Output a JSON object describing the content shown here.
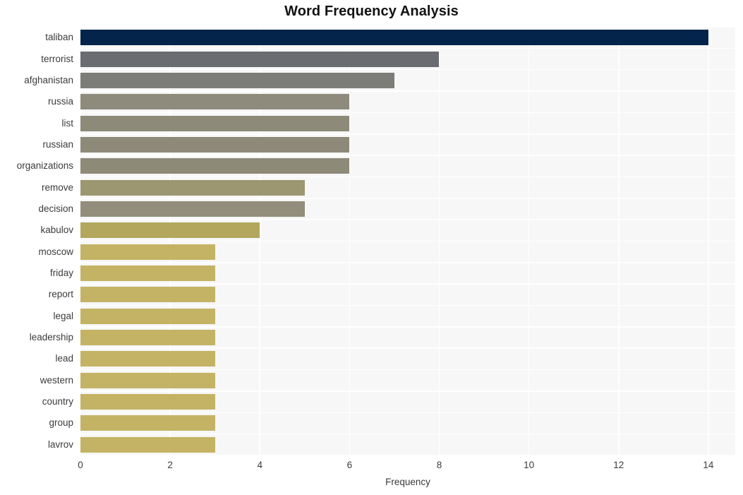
{
  "chart_data": {
    "type": "bar",
    "orientation": "horizontal",
    "title": "Word Frequency Analysis",
    "xlabel": "Frequency",
    "ylabel": "",
    "xlim": [
      0,
      14.6
    ],
    "xticks": [
      0,
      2,
      4,
      6,
      8,
      10,
      12,
      14
    ],
    "xticklabels": [
      "0",
      "2",
      "4",
      "6",
      "8",
      "10",
      "12",
      "14"
    ],
    "grid": true,
    "legend": null,
    "categories": [
      "taliban",
      "terrorist",
      "afghanistan",
      "russia",
      "list",
      "russian",
      "organizations",
      "remove",
      "decision",
      "kabulov",
      "moscow",
      "friday",
      "report",
      "legal",
      "leadership",
      "lead",
      "western",
      "country",
      "group",
      "lavrov"
    ],
    "values": [
      14,
      8,
      7,
      6,
      6,
      6,
      6,
      5,
      5,
      4,
      3,
      3,
      3,
      3,
      3,
      3,
      3,
      3,
      3,
      3
    ],
    "bar_colors": [
      "#04244b",
      "#6a6c72",
      "#7c7c78",
      "#8e8b7c",
      "#8d8a79",
      "#8e8a79",
      "#8e8a78",
      "#9c9671",
      "#928e7b",
      "#b3a75e",
      "#c4b364",
      "#c4b364",
      "#c4b364",
      "#c4b364",
      "#c4b364",
      "#c4b364",
      "#c4b364",
      "#c4b364",
      "#c4b364",
      "#c4b364"
    ],
    "plot_background": "#f7f7f7",
    "grid_color": "#ffffff",
    "figure_background": "#ffffff",
    "text_color": "#3b3b3b",
    "title_color": "#121212"
  }
}
